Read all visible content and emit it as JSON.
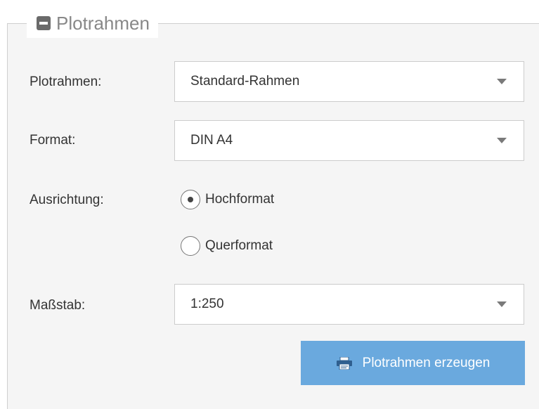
{
  "fieldset": {
    "legend": "Plotrahmen",
    "collapse_icon": "collapse-minus-icon"
  },
  "fields": {
    "frame_label": "Plotrahmen:",
    "frame_value": "Standard-Rahmen",
    "format_label": "Format:",
    "format_value": "DIN A4",
    "orientation_label": "Ausrichtung:",
    "orientation_options": [
      {
        "label": "Hochformat",
        "checked": true
      },
      {
        "label": "Querformat",
        "checked": false
      }
    ],
    "scale_label": "Maßstab:",
    "scale_value": "1:250"
  },
  "actions": {
    "create_label": "Plotrahmen erzeugen",
    "create_icon": "printer-icon"
  },
  "colors": {
    "accent": "#6aa9de",
    "panel_bg": "#f5f5f5"
  }
}
